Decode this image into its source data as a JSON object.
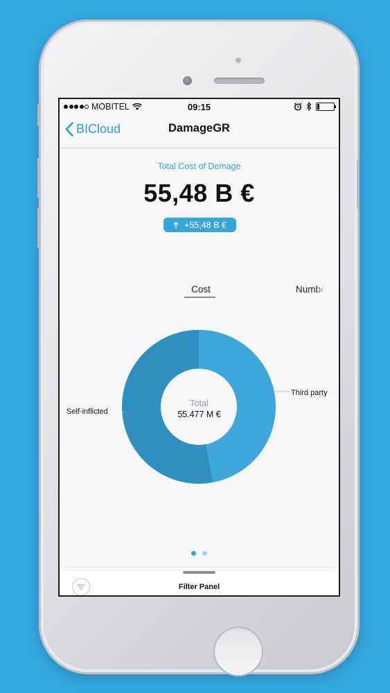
{
  "status_bar": {
    "carrier": "MOBITEL",
    "time": "09:15",
    "signal_bars": 4,
    "icons": [
      "signal-dots-icon",
      "wifi-icon",
      "alarm-icon",
      "bluetooth-icon",
      "battery-icon"
    ],
    "battery_level": 0.15
  },
  "nav": {
    "back_label": "BICloud",
    "title": "DamageGR"
  },
  "kpi": {
    "caption": "Total Cost of Demage",
    "value": "55,48 B €",
    "delta": "+55,48 B €",
    "delta_icon": "arrow-up-icon"
  },
  "tabs": [
    {
      "label": "Cost",
      "selected": true
    },
    {
      "label": "Numbe",
      "selected": false
    }
  ],
  "chart_data": {
    "type": "pie",
    "donut": true,
    "center_label": "Total",
    "center_value": "55.477 M €",
    "slices": [
      {
        "label": "Third party",
        "value": 0.47,
        "color": "#3da7db"
      },
      {
        "label": "Self-inflicted",
        "value": 0.53,
        "color": "#2e8fc0"
      }
    ]
  },
  "pager": {
    "pages": 2,
    "current": 0
  },
  "filter_panel": {
    "label": "Filter Panel",
    "icon": "filter-icon"
  },
  "colors": {
    "background": "#33a8e0",
    "accent": "#3aa4d8",
    "screen": "#f7f7fa"
  }
}
